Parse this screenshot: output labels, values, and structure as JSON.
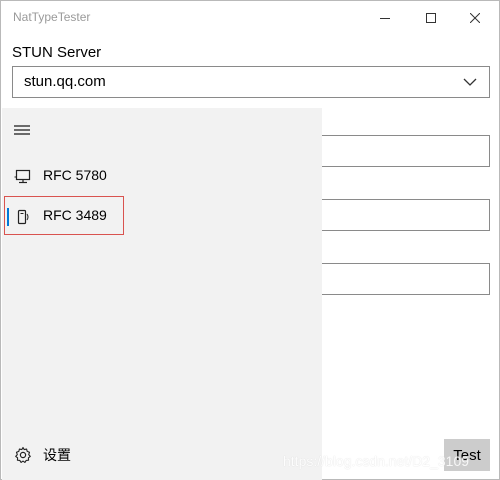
{
  "window": {
    "title": "NatTypeTester",
    "minimize_icon": "minimize-icon",
    "maximize_icon": "maximize-icon",
    "close_icon": "close-icon"
  },
  "stun": {
    "label": "STUN Server",
    "value": "stun.qq.com",
    "dropdown_icon": "chevron-down-icon"
  },
  "nav": {
    "menu_icon": "hamburger-icon",
    "items": [
      {
        "label": "RFC 5780",
        "icon": "monitor-icon",
        "selected": false
      },
      {
        "label": "RFC 3489",
        "icon": "device-icon",
        "selected": true
      }
    ],
    "settings": {
      "label": "设置",
      "icon": "gear-icon"
    },
    "accent_color": "#0078d7",
    "highlight_color": "#d9534f"
  },
  "actions": {
    "test_label": "Test"
  },
  "watermark": "https://blog.csdn.net/D2_3109"
}
